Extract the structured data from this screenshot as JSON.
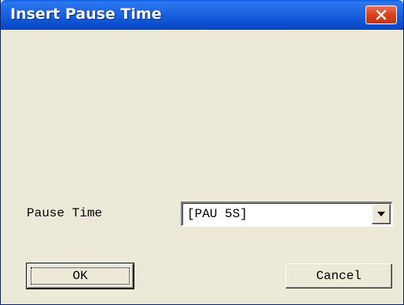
{
  "window": {
    "title": "Insert Pause Time"
  },
  "form": {
    "pause_time_label": "Pause Time",
    "pause_time_value": "[PAU 5S]"
  },
  "buttons": {
    "ok_label": "OK",
    "cancel_label": "Cancel"
  },
  "icons": {
    "close": "close-icon",
    "dropdown": "chevron-down-icon"
  },
  "colors": {
    "titlebar": "#1b64e0",
    "close_button": "#d8421e",
    "dialog_background": "#ece9d8"
  }
}
